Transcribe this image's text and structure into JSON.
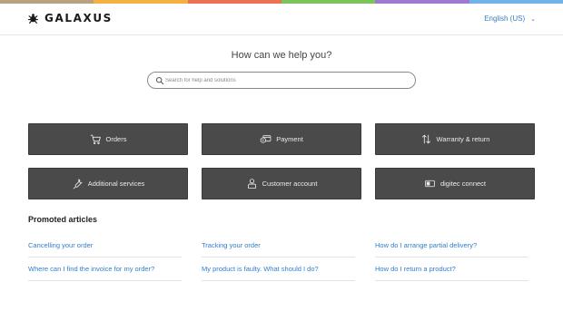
{
  "brand": {
    "name": "GALAXUS"
  },
  "header": {
    "language": "English (US)"
  },
  "top_bar_colors": [
    "#b9a17e",
    "#f2b141",
    "#ec7052",
    "#7bc45a",
    "#9e79cf",
    "#6fb3e8"
  ],
  "hero": {
    "title": "How can we help you?"
  },
  "search": {
    "placeholder": "Search for help and solutions"
  },
  "tiles": [
    {
      "label": "Orders",
      "icon": "cart-icon"
    },
    {
      "label": "Payment",
      "icon": "payment-icon"
    },
    {
      "label": "Warranty & return",
      "icon": "arrows-updown-icon"
    },
    {
      "label": "Additional services",
      "icon": "wrench-icon"
    },
    {
      "label": "Customer account",
      "icon": "user-icon"
    },
    {
      "label": "digitec connect",
      "icon": "sim-card-icon"
    }
  ],
  "promoted": {
    "heading": "Promoted articles",
    "articles": [
      "Cancelling your order",
      "Tracking your order",
      "How do I arrange partial delivery?",
      "Where can I find the invoice for my order?",
      "My product is faulty. What should I do?",
      "How do I return a product?"
    ]
  }
}
